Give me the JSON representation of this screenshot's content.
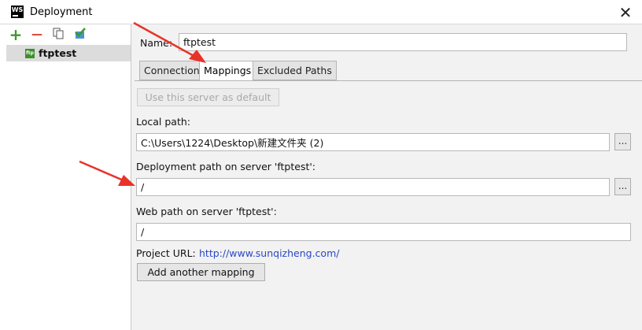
{
  "window": {
    "title": "Deployment",
    "app_icon_text": "WS",
    "close_glyph": "✕"
  },
  "left": {
    "toolbar": {
      "add_glyph": "+",
      "remove_glyph": "—",
      "copy_icon": "copy-icon",
      "default_icon": "checkmark-icon"
    },
    "tree_item": {
      "icon_text": "ftp",
      "label": "ftptest"
    }
  },
  "main": {
    "name_label": "Name:",
    "name_value": "ftptest",
    "tabs": [
      {
        "label": "Connection",
        "active": false
      },
      {
        "label": "Mappings",
        "active": true
      },
      {
        "label": "Excluded Paths",
        "active": false
      }
    ],
    "default_button": "Use this server as default",
    "local_path_label": "Local path:",
    "local_path_value": "C:\\Users\\1224\\Desktop\\新建文件夹 (2)",
    "deployment_path_label": "Deployment path on server 'ftptest':",
    "deployment_path_value": "/",
    "web_path_label": "Web path on server 'ftptest':",
    "web_path_value": "/",
    "project_url_label": "Project URL:",
    "project_url_value": "http://www.sunqizheng.com/",
    "add_mapping_button": "Add another mapping",
    "browse_label": "..."
  },
  "colors": {
    "accent_link": "#2a47c7",
    "annotation_arrow": "#e8332a",
    "add_icon": "#3a9a2a",
    "remove_icon": "#d9362b"
  }
}
